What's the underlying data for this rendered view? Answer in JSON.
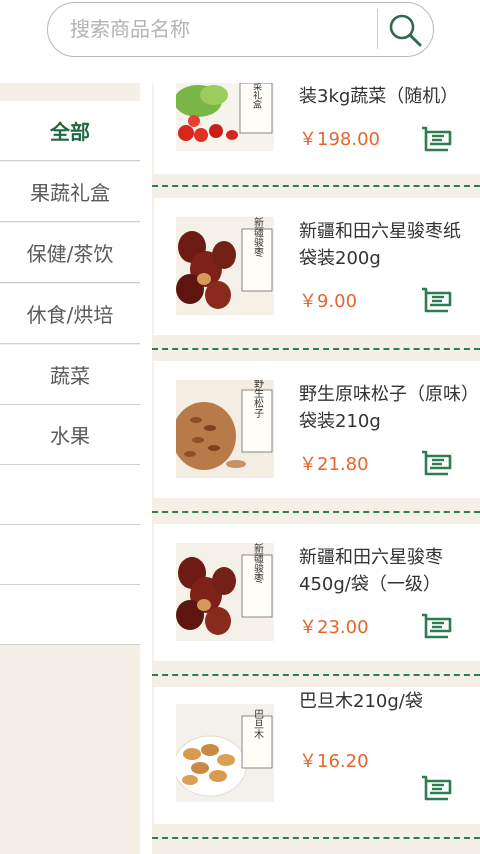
{
  "search": {
    "placeholder": "搜索商品名称"
  },
  "categories": [
    {
      "label": "全部"
    },
    {
      "label": "果蔬礼盒"
    },
    {
      "label": "保健/茶饮"
    },
    {
      "label": "休食/烘培"
    },
    {
      "label": "蔬菜"
    },
    {
      "label": "水果"
    }
  ],
  "products": [
    {
      "name": "装3kg蔬菜（随机）",
      "price": "￥198.00",
      "thumb_text": "菜礼盒",
      "thumb_kind": "vegetables-icon"
    },
    {
      "name": "新疆和田六星骏枣纸袋装200g",
      "price": "￥9.00",
      "thumb_text": "新疆骏枣",
      "thumb_kind": "dates-icon"
    },
    {
      "name": "野生原味松子（原味）袋装210g",
      "price": "￥21.80",
      "thumb_text": "野生松子",
      "thumb_kind": "pine-nuts-icon"
    },
    {
      "name": "新疆和田六星骏枣450g/袋（一级）",
      "price": "￥23.00",
      "thumb_text": "新疆骏枣",
      "thumb_kind": "dates-icon"
    },
    {
      "name": "巴旦木210g/袋",
      "price": "￥16.20",
      "thumb_text": "巴旦木",
      "thumb_kind": "almonds-icon"
    }
  ],
  "colors": {
    "accent": "#1e6a3f",
    "price": "#e5652d",
    "background": "#f4f0e7"
  }
}
